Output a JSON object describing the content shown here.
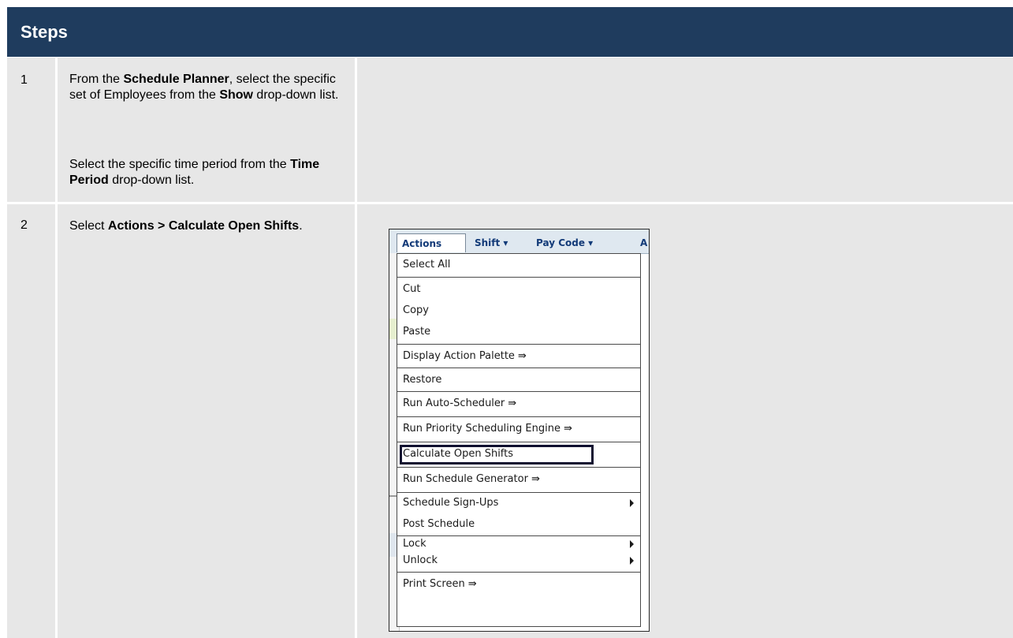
{
  "header": {
    "title": "Steps"
  },
  "steps": [
    {
      "number": "1",
      "p1": [
        {
          "t": "From the ",
          "b": false
        },
        {
          "t": "Schedule Planner",
          "b": true
        },
        {
          "t": ", select the specific set of Employees from the ",
          "b": false
        },
        {
          "t": "Show",
          "b": true
        },
        {
          "t": " drop-down list.",
          "b": false
        }
      ],
      "p2": [
        {
          "t": "Select the specific time period from the ",
          "b": false
        },
        {
          "t": "Time Period",
          "b": true
        },
        {
          "t": " drop-down list.",
          "b": false
        }
      ]
    },
    {
      "number": "2",
      "p1": [
        {
          "t": "Select ",
          "b": false
        },
        {
          "t": "Actions > Calculate Open Shifts",
          "b": true
        },
        {
          "t": ".",
          "b": false
        }
      ]
    }
  ],
  "menu": {
    "tabs": {
      "actions": "Actions",
      "shift": "Shift ▾",
      "paycode": "Pay Code ▾",
      "more": "A"
    },
    "items": {
      "select_all": "Select All",
      "cut": "Cut",
      "copy": "Copy",
      "paste": "Paste",
      "display_action_palette": "Display Action Palette ⇛",
      "restore": "Restore",
      "run_auto_scheduler": "Run Auto-Scheduler ⇛",
      "run_priority_scheduling_engine": "Run Priority Scheduling Engine ⇛",
      "calculate_open_shifts": "Calculate Open Shifts",
      "run_schedule_generator": "Run Schedule Generator ⇛",
      "schedule_sign_ups": "Schedule Sign-Ups",
      "post_schedule": "Post Schedule",
      "lock": "Lock",
      "unlock": "Unlock",
      "print_screen": "Print Screen ⇛"
    }
  }
}
